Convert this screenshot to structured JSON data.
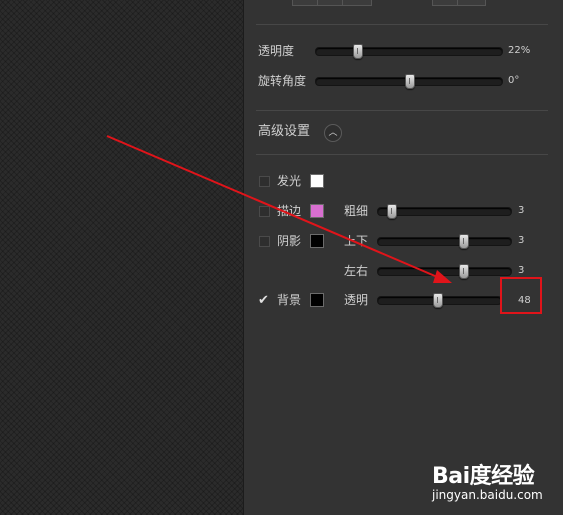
{
  "panel": {
    "opacity": {
      "label": "透明度",
      "value_text": "22%",
      "level": 0.22
    },
    "rotation": {
      "label": "旋转角度",
      "value_text": "0°",
      "level": 0.5
    },
    "advanced": {
      "title": "高级设置",
      "toggle_icon": "chevron-up-icon"
    },
    "glow": {
      "label": "发光",
      "checked": false,
      "color": "#ffffff"
    },
    "stroke": {
      "label": "描边",
      "checked": false,
      "color": "#d86fd0",
      "slider": {
        "label": "粗细",
        "value_text": "3",
        "level": 0.1
      }
    },
    "shadow": {
      "label": "阴影",
      "checked": false,
      "color": "#000000",
      "slider_v": {
        "label": "上下",
        "value_text": "3",
        "level": 0.64
      },
      "slider_h": {
        "label": "左右",
        "value_text": "3",
        "level": 0.64
      }
    },
    "background": {
      "label": "背景",
      "checked": true,
      "color": "#000000",
      "slider": {
        "label": "透明",
        "value_text": "48",
        "level": 0.48
      }
    }
  },
  "annotation": {
    "color": "#e0141a"
  },
  "watermark": {
    "logo": "Bai度经验",
    "url": "jingyan.baidu.com"
  }
}
